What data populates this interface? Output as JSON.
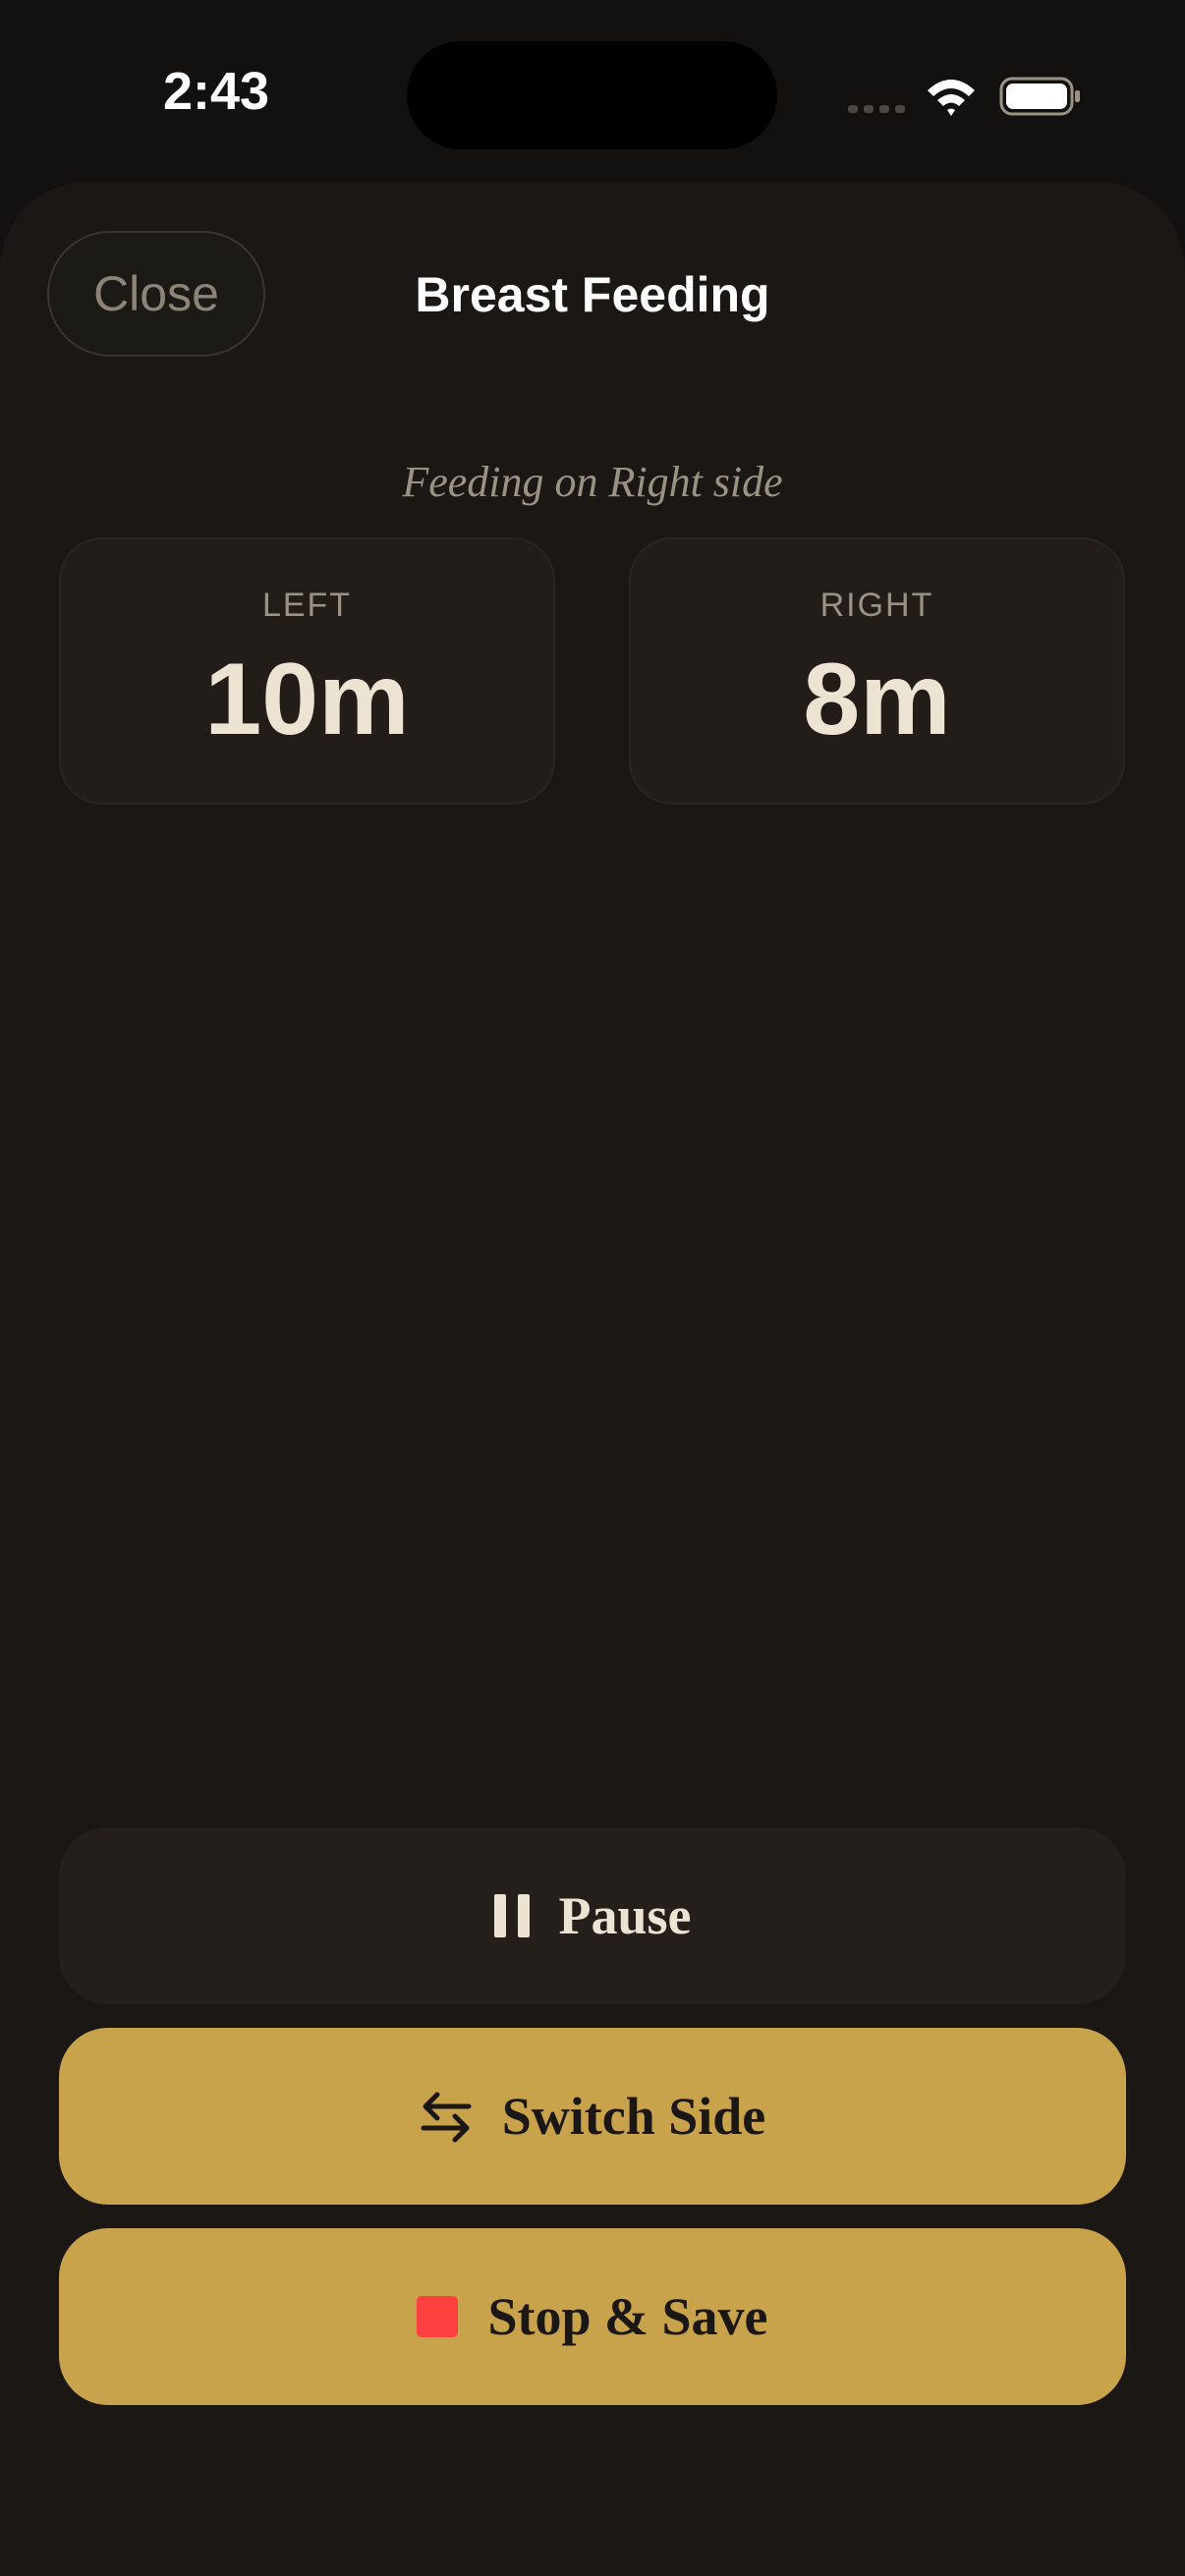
{
  "status_bar": {
    "time": "2:43"
  },
  "header": {
    "close_label": "Close",
    "title": "Breast Feeding"
  },
  "feeding": {
    "status_text": "Feeding on Right side",
    "sides": [
      {
        "label": "LEFT",
        "value": "10m"
      },
      {
        "label": "RIGHT",
        "value": "8m"
      }
    ]
  },
  "actions": {
    "pause_label": "Pause",
    "switch_label": "Switch Side",
    "stop_label": "Stop & Save"
  },
  "icons": {
    "pause": "pause-icon",
    "switch": "switch-arrows-icon",
    "stop": "stop-square-icon",
    "wifi": "wifi-icon",
    "battery": "battery-icon",
    "signal": "signal-dots-icon"
  },
  "colors": {
    "background": "#121110",
    "sheet": "#1a1714",
    "card": "#221d18",
    "accent": "#c9a24c",
    "stop": "#ff4040",
    "text_primary": "#ede3d2",
    "text_muted": "#9a9284"
  }
}
